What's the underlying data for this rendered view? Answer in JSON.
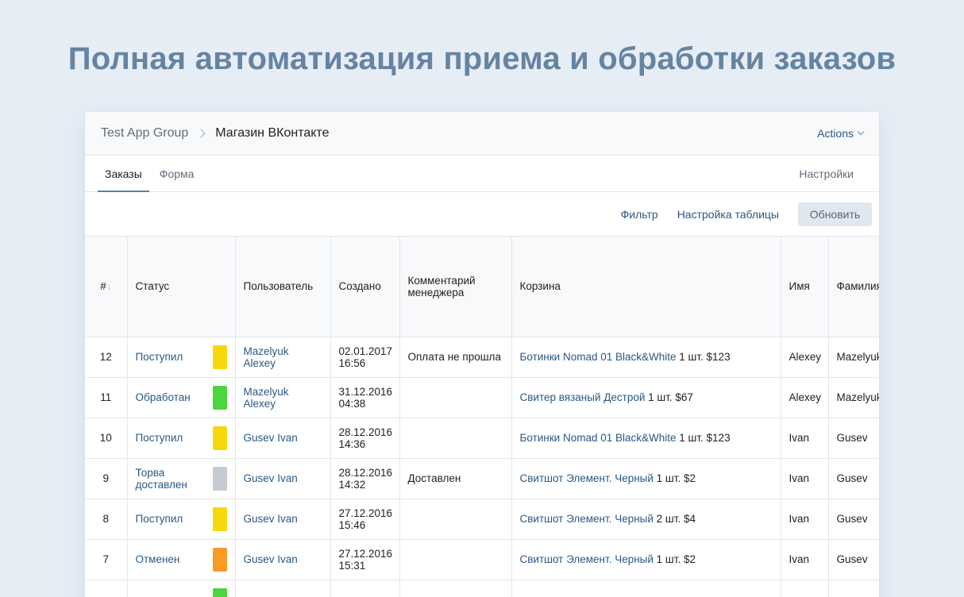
{
  "hero_title": "Полная автоматизация приема и обработки заказов",
  "breadcrumb": {
    "parent": "Test App Group",
    "current": "Магазин ВКонтакте"
  },
  "actions_label": "Actions",
  "tabs": [
    {
      "label": "Заказы",
      "active": true
    },
    {
      "label": "Форма",
      "active": false
    }
  ],
  "settings_label": "Настройки",
  "toolbar": {
    "filter": "Фильтр",
    "table_settings": "Настройка таблицы",
    "refresh": "Обновить"
  },
  "columns": {
    "num": "#",
    "sort_glyph": "↓",
    "status": "Статус",
    "user": "Пользователь",
    "created": "Создано",
    "comment": "Комментарий менеджера",
    "cart": "Корзина",
    "first_name": "Имя",
    "last_name": "Фамилия"
  },
  "colors": {
    "yellow": "#f5d90a",
    "green": "#4cd53d",
    "gray": "#c5cbd3",
    "orange": "#f79a26",
    "link": "#2a5885",
    "hero": "#6584a2"
  },
  "rows": [
    {
      "num": "12",
      "status": "Поступил",
      "status_color": "#f5d90a",
      "user": "Mazelyuk Alexey",
      "created_date": "02.01.2017",
      "created_time": "16:56",
      "comment": "Оплата не прошла",
      "cart_item": "Ботинки Nomad 01 Black&White",
      "cart_qty": " 1 шт. $123",
      "first_name": "Alexey",
      "last_name": "Mazelyuk"
    },
    {
      "num": "11",
      "status": "Обработан",
      "status_color": "#4cd53d",
      "user": "Mazelyuk Alexey",
      "created_date": "31.12.2016",
      "created_time": "04:38",
      "comment": "",
      "cart_item": "Свитер вязаный Дестрой",
      "cart_qty": " 1 шт. $67",
      "first_name": "Alexey",
      "last_name": "Mazelyuk"
    },
    {
      "num": "10",
      "status": "Поступил",
      "status_color": "#f5d90a",
      "user": "Gusev Ivan",
      "created_date": "28.12.2016",
      "created_time": "14:36",
      "comment": "",
      "cart_item": "Ботинки Nomad 01 Black&White",
      "cart_qty": " 1 шт. $123",
      "first_name": "Ivan",
      "last_name": "Gusev"
    },
    {
      "num": "9",
      "status": "Торва доставлен",
      "status_color": "#c5cbd3",
      "user": "Gusev Ivan",
      "created_date": "28.12.2016",
      "created_time": "14:32",
      "comment": "Доставлен",
      "cart_item": "Свитшот Элемент. Черный",
      "cart_qty": " 1 шт. $2",
      "first_name": "Ivan",
      "last_name": "Gusev"
    },
    {
      "num": "8",
      "status": "Поступил",
      "status_color": "#f5d90a",
      "user": "Gusev Ivan",
      "created_date": "27.12.2016",
      "created_time": "15:46",
      "comment": "",
      "cart_item": "Свитшот Элемент. Черный",
      "cart_qty": " 2 шт. $4",
      "first_name": "Ivan",
      "last_name": "Gusev"
    },
    {
      "num": "7",
      "status": "Отменен",
      "status_color": "#f79a26",
      "user": "Gusev Ivan",
      "created_date": "27.12.2016",
      "created_time": "15:31",
      "comment": "",
      "cart_item": "Свитшот Элемент. Черный",
      "cart_qty": " 1 шт. $2",
      "first_name": "Ivan",
      "last_name": "Gusev"
    },
    {
      "num": "",
      "status": "",
      "status_color": "#4cd53d",
      "user": "",
      "created_date": "",
      "created_time": "",
      "comment": "",
      "cart_item": "",
      "cart_qty": "",
      "first_name": "",
      "last_name": ""
    }
  ]
}
